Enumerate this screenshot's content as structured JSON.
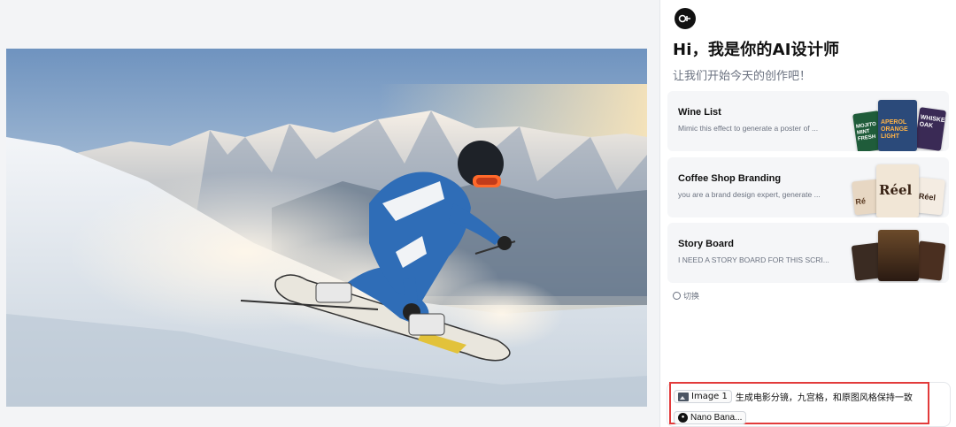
{
  "panel": {
    "greeting": "Hi，我是你的AI设计师",
    "subtitle": "让我们开始今天的创作吧！",
    "cards": [
      {
        "title": "Wine List",
        "desc": "Mimic this effect to generate a poster of ..."
      },
      {
        "title": "Coffee Shop Branding",
        "desc": "you are a brand design expert, generate ..."
      },
      {
        "title": "Story Board",
        "desc": "I NEED A STORY BOARD FOR THIS SCRI..."
      }
    ],
    "switch_label": "切换"
  },
  "thumb_text": {
    "wine_left": "MOJITO MINT FRESH",
    "wine_center": "APEROL ORANGE LIGHT",
    "wine_right": "WHISKEY OAK",
    "coffee_center": "Réel",
    "coffee_left": "Ré",
    "coffee_right": "Réel"
  },
  "input": {
    "image_chip": "Image 1",
    "prompt": "生成电影分镜，九宫格，和原图风格保持一致",
    "model_chip": "Nano Bana..."
  },
  "colors": {
    "highlight": "#e23b3b",
    "panel_bg": "#ffffff",
    "canvas_bg": "#f3f4f6"
  }
}
